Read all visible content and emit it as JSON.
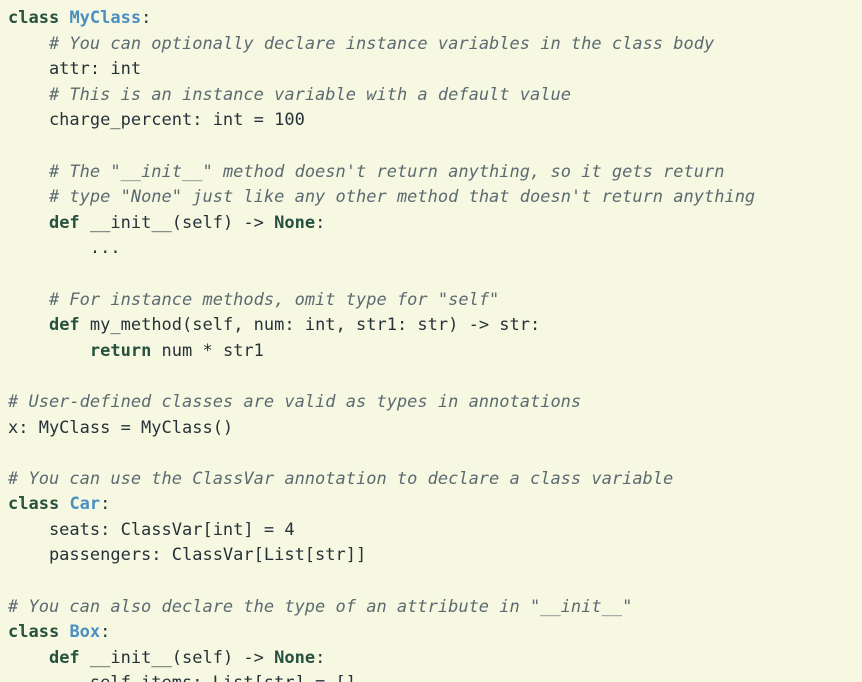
{
  "editor": {
    "background": "#f7f8e1",
    "colors": {
      "keyword": "#27513f",
      "class_name": "#4a8fc2",
      "comment": "#5c6b72",
      "text": "#26323a"
    },
    "lines": [
      [
        {
          "t": "class",
          "c": "kw"
        },
        {
          "t": " ",
          "c": "pl"
        },
        {
          "t": "MyClass",
          "c": "cls"
        },
        {
          "t": ":",
          "c": "pl"
        }
      ],
      [
        {
          "t": "    ",
          "c": "pl"
        },
        {
          "t": "# You can optionally declare instance variables in the class body",
          "c": "cm"
        }
      ],
      [
        {
          "t": "    attr: int",
          "c": "pl"
        }
      ],
      [
        {
          "t": "    ",
          "c": "pl"
        },
        {
          "t": "# This is an instance variable with a default value",
          "c": "cm"
        }
      ],
      [
        {
          "t": "    charge_percent: int = 100",
          "c": "pl"
        }
      ],
      [],
      [
        {
          "t": "    ",
          "c": "pl"
        },
        {
          "t": "# The \"__init__\" method doesn't return anything, so it gets return",
          "c": "cm"
        }
      ],
      [
        {
          "t": "    ",
          "c": "pl"
        },
        {
          "t": "# type \"None\" just like any other method that doesn't return anything",
          "c": "cm"
        }
      ],
      [
        {
          "t": "    ",
          "c": "pl"
        },
        {
          "t": "def",
          "c": "kw"
        },
        {
          "t": " __init__(self) -> ",
          "c": "pl"
        },
        {
          "t": "None",
          "c": "kw"
        },
        {
          "t": ":",
          "c": "pl"
        }
      ],
      [
        {
          "t": "        ...",
          "c": "pl"
        }
      ],
      [],
      [
        {
          "t": "    ",
          "c": "pl"
        },
        {
          "t": "# For instance methods, omit type for \"self\"",
          "c": "cm"
        }
      ],
      [
        {
          "t": "    ",
          "c": "pl"
        },
        {
          "t": "def",
          "c": "kw"
        },
        {
          "t": " my_method(self, num: int, str1: str) -> str:",
          "c": "pl"
        }
      ],
      [
        {
          "t": "        ",
          "c": "pl"
        },
        {
          "t": "return",
          "c": "kw"
        },
        {
          "t": " num * str1",
          "c": "pl"
        }
      ],
      [],
      [
        {
          "t": "# User-defined classes are valid as types in annotations",
          "c": "cm"
        }
      ],
      [
        {
          "t": "x: MyClass = MyClass()",
          "c": "pl"
        }
      ],
      [],
      [
        {
          "t": "# You can use the ClassVar annotation to declare a class variable",
          "c": "cm"
        }
      ],
      [
        {
          "t": "class",
          "c": "kw"
        },
        {
          "t": " ",
          "c": "pl"
        },
        {
          "t": "Car",
          "c": "cls"
        },
        {
          "t": ":",
          "c": "pl"
        }
      ],
      [
        {
          "t": "    seats: ClassVar[int] = 4",
          "c": "pl"
        }
      ],
      [
        {
          "t": "    passengers: ClassVar[List[str]]",
          "c": "pl"
        }
      ],
      [],
      [
        {
          "t": "# You can also declare the type of an attribute in \"__init__\"",
          "c": "cm"
        }
      ],
      [
        {
          "t": "class",
          "c": "kw"
        },
        {
          "t": " ",
          "c": "pl"
        },
        {
          "t": "Box",
          "c": "cls"
        },
        {
          "t": ":",
          "c": "pl"
        }
      ],
      [
        {
          "t": "    ",
          "c": "pl"
        },
        {
          "t": "def",
          "c": "kw"
        },
        {
          "t": " __init__(self) -> ",
          "c": "pl"
        },
        {
          "t": "None",
          "c": "kw"
        },
        {
          "t": ":",
          "c": "pl"
        }
      ],
      [
        {
          "t": "        self.items: List[str] = []",
          "c": "pl"
        }
      ]
    ]
  }
}
